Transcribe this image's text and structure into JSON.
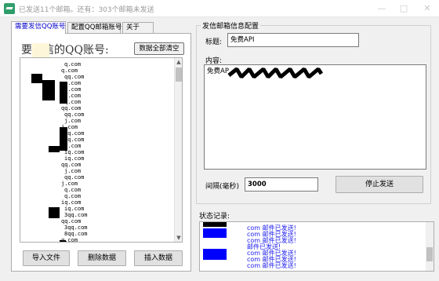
{
  "window": {
    "title": "已发送11个邮箱。还有：303个邮箱未发送",
    "minimize": "—",
    "maximize": "□",
    "close": "✕"
  },
  "tabs": [
    {
      "label": "需要发信QQ账号",
      "active": true
    },
    {
      "label": "配置QQ邮箱账号",
      "active": false
    },
    {
      "label": "关于",
      "active": false
    }
  ],
  "left_panel": {
    "heading": "要发信的QQ账号:",
    "clear_button": "数据全部清空",
    "list_items": [
      "q.com",
      "q.com",
      "qq.com",
      "q.com",
      "qq.com",
      "q.com",
      "q.com",
      "qq.com",
      "qq.com",
      "j.com",
      "j.com",
      "iq.com",
      "iq.com",
      "iq.com",
      "iq.com",
      "iq.com",
      "qq.com",
      "j.com",
      "qq.com",
      "j.com",
      "q.com",
      "q.com",
      "iq.com",
      "iq.com",
      "3qq.com",
      "qq.com",
      "3qq.com",
      "8qq.com",
      "q.com"
    ],
    "buttons": {
      "import": "导入文件",
      "delete": "删除数据",
      "insert": "插入数据"
    }
  },
  "config": {
    "group_title": "发信邮箱信息配置",
    "title_label": "标题:",
    "title_value": "免费API",
    "content_label": "内容:",
    "content_value": "免费AP",
    "interval_label": "间隔(毫秒)",
    "interval_value": "3000",
    "stop_button": "停止发送"
  },
  "log": {
    "label": "状态记录:",
    "lines": [
      "com 邮件已发送!",
      "com 邮件已发送!",
      "com 邮件已发送!",
      "邮件已发送!",
      "com 邮件已发送!",
      "com 邮件已发送!",
      "com 邮件已发送!"
    ]
  },
  "colors": {
    "active_tab_text": "#0000cc",
    "log_text": "#1a1aee",
    "redaction": "#000000",
    "redaction_blue": "#0000ff"
  }
}
